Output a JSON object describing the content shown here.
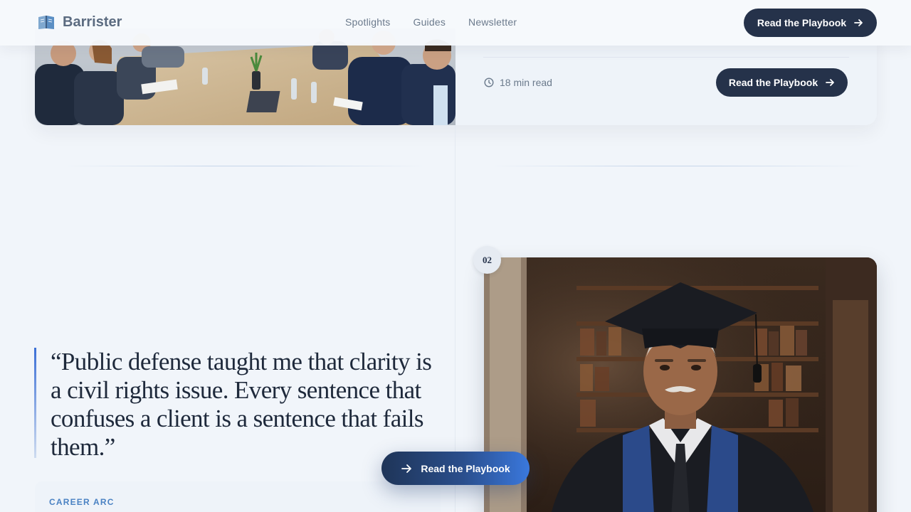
{
  "header": {
    "brand": "Barrister",
    "nav": [
      "Spotlights",
      "Guides",
      "Newsletter"
    ],
    "cta_label": "Read the Playbook"
  },
  "top_article": {
    "read_time": "18 min read",
    "cta_label": "Read the Playbook"
  },
  "feature": {
    "number": "02",
    "quote": "“Public defense taught me that clarity is a civil rights issue. Every sentence that confuses a client is a sentence that fails them.”",
    "section_label": "CAREER ARC"
  },
  "floating_cta": {
    "label": "Read the Playbook"
  },
  "colors": {
    "background": "#f1f5fa",
    "primary_dark": "#25324a",
    "accent_blue": "#3a78dd",
    "label_blue": "#4a82c3"
  },
  "icons": {
    "brand": "book-icon",
    "arrow": "arrow-right-icon",
    "clock": "clock-icon"
  }
}
